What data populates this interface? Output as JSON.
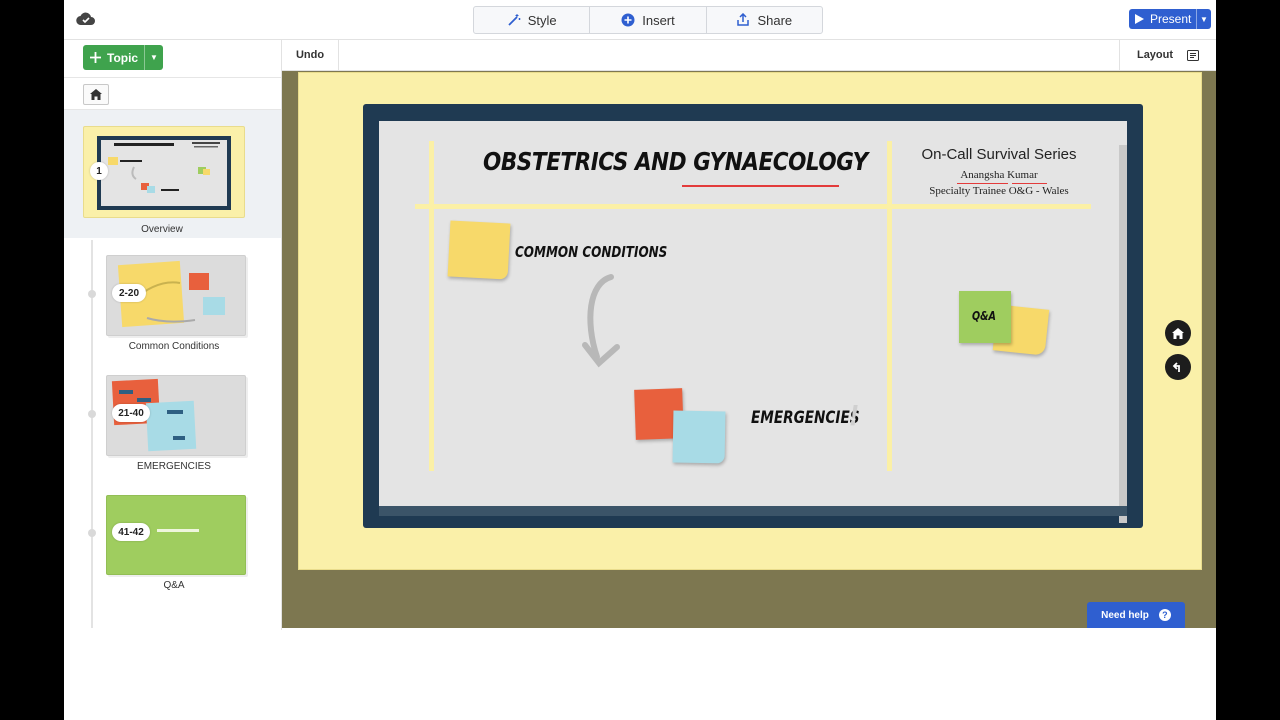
{
  "toolbar": {
    "style_label": "Style",
    "insert_label": "Insert",
    "share_label": "Share",
    "present_label": "Present",
    "undo_label": "Undo",
    "layout_label": "Layout"
  },
  "sidebar": {
    "topic_label": "Topic",
    "items": [
      {
        "badge": "1",
        "label": "Overview"
      },
      {
        "badge": "2-20",
        "label": "Common Conditions"
      },
      {
        "badge": "21-40",
        "label": "EMERGENCIES"
      },
      {
        "badge": "41-42",
        "label": "Q&A"
      }
    ]
  },
  "slide": {
    "title": "OBSTETRICS AND GYNAECOLOGY",
    "series": "On-Call Survival Series",
    "author": "Anangsha  Kumar",
    "role": "Specialty Trainee O&G - Wales",
    "common_conditions": "COMMON CONDITIONS",
    "emergencies": "EMERGENCIES",
    "exclaim": "!",
    "qa": "Q&A"
  },
  "help": {
    "label": "Need help",
    "icon_text": "?"
  },
  "colors": {
    "accent": "#2f5fd0",
    "topic_green": "#3fa34d",
    "frame": "#1f3a52",
    "canvas_bg": "#7d7750",
    "paper": "#faf0a9",
    "note_yellow": "#f7d96a",
    "note_orange": "#e8603d",
    "note_blue": "#a8dbe6",
    "note_green": "#9fcd5f"
  }
}
